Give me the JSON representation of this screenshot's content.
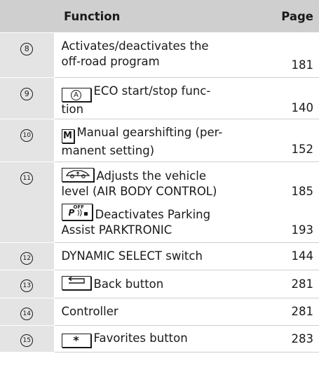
{
  "header": {
    "col_function": "Function",
    "col_page": "Page"
  },
  "rows": [
    {
      "num": "8",
      "lines": [
        "Activates/deactivates the",
        "off-road program"
      ],
      "page": "181"
    },
    {
      "num": "9",
      "key_glyph": "A",
      "lines": [
        "ECO start/stop func-",
        "tion"
      ],
      "page": "140"
    },
    {
      "num": "10",
      "key_glyph": "M",
      "lines": [
        "Manual gearshifting (per-",
        "manent setting)"
      ],
      "page": "152"
    },
    {
      "num": "11",
      "sub1_lines": [
        "Adjusts the vehicle",
        "level (AIR BODY CONTROL)"
      ],
      "sub1_page": "185",
      "sub2_key_text": "P",
      "sub2_key_sup": "OFF",
      "sub2_lines": [
        "Deactivates Parking",
        "Assist PARKTRONIC"
      ],
      "sub2_page": "193"
    },
    {
      "num": "12",
      "text": "DYNAMIC SELECT switch",
      "page": "144"
    },
    {
      "num": "13",
      "text": "Back button",
      "page": "281"
    },
    {
      "num": "14",
      "text": "Controller",
      "page": "281"
    },
    {
      "num": "15",
      "key_glyph": "*",
      "text": "Favorites button",
      "page": "283"
    }
  ]
}
